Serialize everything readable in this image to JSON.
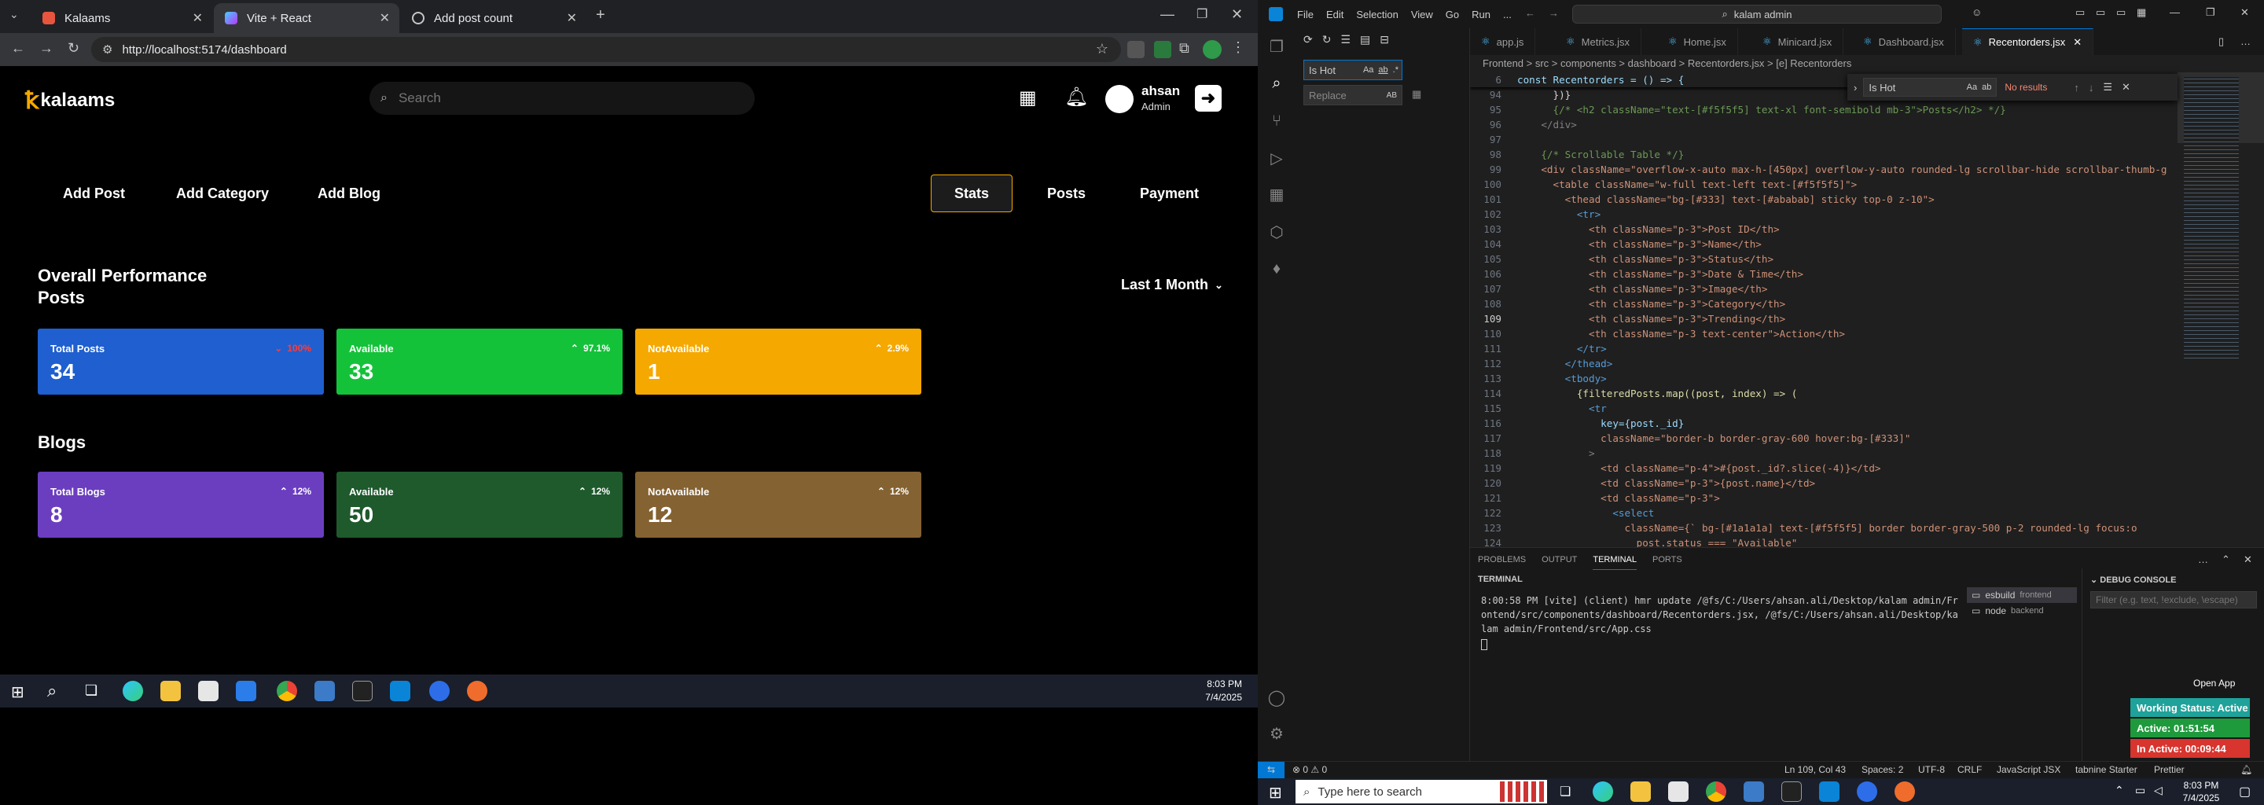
{
  "browser": {
    "tabs": [
      {
        "label": "Kalaams",
        "color": "#e8553e"
      },
      {
        "label": "Vite + React",
        "color": "#a56bff"
      },
      {
        "label": "Add post count",
        "color": "#888888"
      }
    ],
    "url": "http://localhost:5174/dashboard"
  },
  "site": {
    "logo": "kalaams",
    "search_placeholder": "Search",
    "user_name": "ahsan",
    "user_role": "Admin",
    "actions": [
      "Add Post",
      "Add Category",
      "Add Blog"
    ],
    "tabs": [
      "Stats",
      "Posts",
      "Payment"
    ],
    "active_tab": "Stats",
    "section_title": "Overall Performance",
    "posts_heading": "Posts",
    "filter": "Last 1 Month",
    "posts_cards": [
      {
        "title": "Total Posts",
        "value": "34",
        "pct": "100%",
        "dir": "down",
        "color": "#1f5fcf",
        "pctColor": "#ff3b3b"
      },
      {
        "title": "Available",
        "value": "33",
        "pct": "97.1%",
        "dir": "up",
        "color": "#14c23a",
        "pctColor": "#ffffff"
      },
      {
        "title": "NotAvailable",
        "value": "1",
        "pct": "2.9%",
        "dir": "up",
        "color": "#f5a800",
        "pctColor": "#ffffff"
      }
    ],
    "blogs_heading": "Blogs",
    "blogs_cards": [
      {
        "title": "Total Blogs",
        "value": "8",
        "pct": "12%",
        "dir": "up",
        "color": "#6b3ec0",
        "pctColor": "#ffffff"
      },
      {
        "title": "Available",
        "value": "50",
        "pct": "12%",
        "dir": "up",
        "color": "#1e5a2c",
        "pctColor": "#ffffff"
      },
      {
        "title": "NotAvailable",
        "value": "12",
        "pct": "12%",
        "dir": "up",
        "color": "#846232",
        "pctColor": "#ffffff"
      }
    ]
  },
  "left_taskbar": {
    "time": "8:03 PM",
    "date": "7/4/2025"
  },
  "vscode": {
    "menu": [
      "File",
      "Edit",
      "Selection",
      "View",
      "Go",
      "Run",
      "..."
    ],
    "command_center": "kalam admin",
    "search": {
      "find": "Is Hot",
      "replace_placeholder": "Replace",
      "aa": "Aa",
      "ab": "ab",
      "case": "AB"
    },
    "tabs": [
      "app.js",
      "Metrics.jsx",
      "Home.jsx",
      "Minicard.jsx",
      "Dashboard.jsx",
      "Recentorders.jsx"
    ],
    "active_tab": "Recentorders.jsx",
    "breadcrumb": "Frontend > src > components > dashboard > Recentorders.jsx > [e] Recentorders",
    "find_widget": {
      "query": "Is Hot",
      "result": "No results"
    },
    "code_lines": [
      {
        "n": "6",
        "t": "const Recentorders = () => {",
        "c": "#9cdcfe"
      },
      {
        "n": "94",
        "t": "      })}",
        "c": "#d4d4d4"
      },
      {
        "n": "95",
        "t": "      {/* <h2 className=\"text-[#f5f5f5] text-xl font-semibold mb-3\">Posts</h2> */}",
        "c": "#6a9955"
      },
      {
        "n": "96",
        "t": "    </div>",
        "c": "#808080"
      },
      {
        "n": "97",
        "t": "",
        "c": "#d4d4d4"
      },
      {
        "n": "98",
        "t": "    {/* Scrollable Table */}",
        "c": "#6a9955"
      },
      {
        "n": "99",
        "t": "    <div className=\"overflow-x-auto max-h-[450px] overflow-y-auto rounded-lg scrollbar-hide scrollbar-thumb-g",
        "c": "#ce9178"
      },
      {
        "n": "100",
        "t": "      <table className=\"w-full text-left text-[#f5f5f5]\">",
        "c": "#ce9178"
      },
      {
        "n": "101",
        "t": "        <thead className=\"bg-[#333] text-[#ababab] sticky top-0 z-10\">",
        "c": "#ce9178"
      },
      {
        "n": "102",
        "t": "          <tr>",
        "c": "#569cd6"
      },
      {
        "n": "103",
        "t": "            <th className=\"p-3\">Post ID</th>",
        "c": "#ce9178"
      },
      {
        "n": "104",
        "t": "            <th className=\"p-3\">Name</th>",
        "c": "#ce9178"
      },
      {
        "n": "105",
        "t": "            <th className=\"p-3\">Status</th>",
        "c": "#ce9178"
      },
      {
        "n": "106",
        "t": "            <th className=\"p-3\">Date & Time</th>",
        "c": "#ce9178"
      },
      {
        "n": "107",
        "t": "            <th className=\"p-3\">Image</th>",
        "c": "#ce9178"
      },
      {
        "n": "108",
        "t": "            <th className=\"p-3\">Category</th>",
        "c": "#ce9178"
      },
      {
        "n": "109",
        "t": "            <th className=\"p-3\">Trending</th>",
        "c": "#ce9178"
      },
      {
        "n": "110",
        "t": "            <th className=\"p-3 text-center\">Action</th>",
        "c": "#ce9178"
      },
      {
        "n": "111",
        "t": "          </tr>",
        "c": "#569cd6"
      },
      {
        "n": "112",
        "t": "        </thead>",
        "c": "#569cd6"
      },
      {
        "n": "113",
        "t": "        <tbody>",
        "c": "#569cd6"
      },
      {
        "n": "114",
        "t": "          {filteredPosts.map((post, index) => (",
        "c": "#dcdcaa"
      },
      {
        "n": "115",
        "t": "            <tr",
        "c": "#569cd6"
      },
      {
        "n": "116",
        "t": "              key={post._id}",
        "c": "#9cdcfe"
      },
      {
        "n": "117",
        "t": "              className=\"border-b border-gray-600 hover:bg-[#333]\"",
        "c": "#ce9178"
      },
      {
        "n": "118",
        "t": "            >",
        "c": "#808080"
      },
      {
        "n": "119",
        "t": "              <td className=\"p-4\">#{post._id?.slice(-4)}</td>",
        "c": "#ce9178"
      },
      {
        "n": "120",
        "t": "              <td className=\"p-3\">{post.name}</td>",
        "c": "#ce9178"
      },
      {
        "n": "121",
        "t": "              <td className=\"p-3\">",
        "c": "#ce9178"
      },
      {
        "n": "122",
        "t": "                <select",
        "c": "#569cd6"
      },
      {
        "n": "123",
        "t": "                  className={` bg-[#1a1a1a] text-[#f5f5f5] border border-gray-500 p-2 rounded-lg focus:o",
        "c": "#ce9178"
      },
      {
        "n": "124",
        "t": "                    post.status === \"Available\"",
        "c": "#ce9178"
      }
    ],
    "panel_tabs": [
      "PROBLEMS",
      "OUTPUT",
      "TERMINAL",
      "PORTS"
    ],
    "active_panel": "TERMINAL",
    "terminal_title": "TERMINAL",
    "terminal_text": "8:00:58 PM [vite] (client) hmr update /@fs/C:/Users/ahsan.ali/Desktop/kalam admin/Frontend/src/components/dashboard/Recentorders.jsx, /@fs/C:/Users/ahsan.ali/Desktop/kalam admin/Frontend/src/App.css",
    "terminals": [
      {
        "name": "esbuild",
        "sub": "frontend"
      },
      {
        "name": "node",
        "sub": "backend"
      }
    ],
    "debug_title": "DEBUG CONSOLE",
    "debug_placeholder": "Filter (e.g. text, !exclude, \\escape)",
    "status": {
      "errors": "0",
      "warnings": "0",
      "position": "Ln 109, Col 43",
      "spaces": "Spaces: 2",
      "encoding": "UTF-8",
      "eol": "CRLF",
      "language": "JavaScript JSX",
      "tabnine": "tabnine Starter",
      "prettier": "Prettier"
    }
  },
  "tracker": {
    "open_app": "Open App",
    "working": "Working Status: Active",
    "active": "Active: 01:51:54",
    "inactive": "In Active: 00:09:44"
  },
  "right_taskbar": {
    "search_placeholder": "Type here to search",
    "time": "8:03 PM",
    "date": "7/4/2025"
  }
}
